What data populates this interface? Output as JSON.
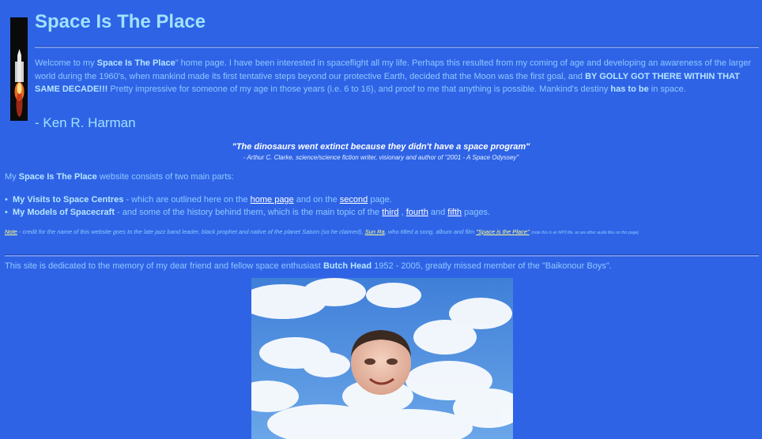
{
  "page": {
    "title": "Space Is The Place",
    "intro": {
      "p1": "Welcome to my ",
      "p2": "Space Is The Place",
      "p3": "\" home page. I have been interested in spaceflight all my life. Perhaps this resulted from my coming of age and developing an awareness of the larger world during the 1960's, when mankind made its first tentative steps beyond our protective Earth, decided that the Moon was the first goal, and ",
      "p4": "BY GOLLY GOT THERE WITHIN THAT SAME DECADE!!!",
      "p5": " Pretty impressive for someone of my age in those years (i.e. 6 to 16), and proof to me that anything is possible. Mankind's destiny ",
      "p6": "has to be",
      "p7": " in space."
    },
    "author": "- Ken R. Harman",
    "quote": "\"The dinosaurs went extinct because they didn't have a space program\"",
    "quote_attribution": "- Arthur C. Clarke, science/science fiction writer, visionary and author of \"2001 - A Space Odyssey\"",
    "parts": {
      "p1": "My ",
      "p2": "Space Is The Place",
      "p3": " website consists of two main parts:"
    },
    "list": {
      "item1": {
        "bold": "My Visits to Space Centres",
        "text": " - which are outlined here on the ",
        "link1": "home page",
        "mid": " and on the ",
        "link2": "second",
        "end": " page."
      },
      "item2": {
        "bold": "My Models of Spacecraft",
        "text": " - and some of the history behind them, which is the main topic of the ",
        "link1": "third",
        "sep1": " , ",
        "link2": "fourth",
        "sep2": " and ",
        "link3": "fifth",
        "end": " pages."
      }
    },
    "note": {
      "link_note": "Note",
      "text1": " - credit for the name of this website goes to the late jazz band leader, black prophet and native of the planet Saturn (so he claimed), ",
      "link_sunra": "Sun Ra",
      "text2": ", who titled a song, album and film ",
      "link_song": "\"Space is the Place\"",
      "text3": ". (note this is an MP3 file, as are other audio files on this page)"
    },
    "dedication": {
      "p1": "This site is dedicated to the memory of my dear friend and fellow space enthusiast ",
      "p2": "Butch Head",
      "p3": " 1952 - 2005, greatly missed member of the \"Baikonour Boys\"."
    }
  },
  "colors": {
    "background": "#2f63e6",
    "text": "#8ec9ff",
    "title": "#9fe2ff",
    "link": "#ffffff",
    "note_link": "#ffff88"
  },
  "icons": {
    "rocket": "space-shuttle-launch-image",
    "photo": "man-face-in-clouds-photo"
  }
}
